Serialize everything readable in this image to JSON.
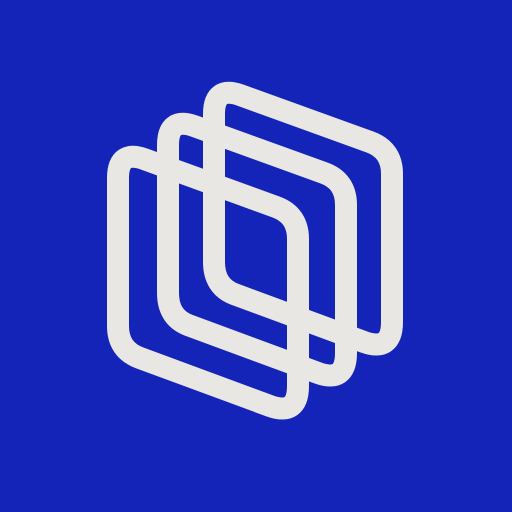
{
  "background_color": "#1423b8",
  "logo": {
    "icon_name": "layered-rounded-rhombus-logo-icon",
    "stroke_color": "#e8e7e3",
    "layer_count": 3
  }
}
